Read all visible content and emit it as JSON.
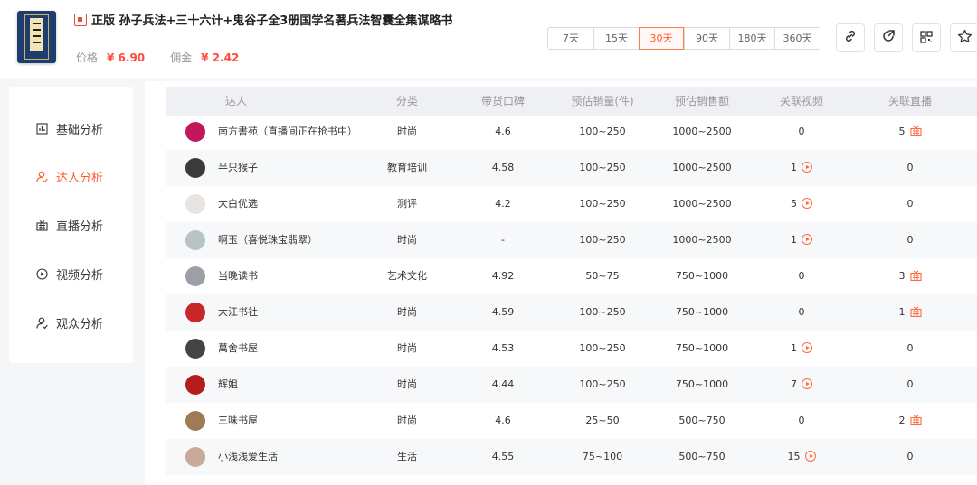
{
  "product": {
    "title": "正版 孙子兵法+三十六计+鬼谷子全3册国学名著兵法智囊全集谋略书",
    "price_label": "价格",
    "price": "¥ 6.90",
    "commission_label": "佣金",
    "commission": "¥ 2.42"
  },
  "time_ranges": [
    "7天",
    "15天",
    "30天",
    "90天",
    "180天",
    "360天"
  ],
  "active_range": "30天",
  "toolbar_icons": [
    "link-icon",
    "share-icon",
    "qrcode-icon",
    "star-icon"
  ],
  "sidebar": {
    "items": [
      {
        "label": "基础分析",
        "icon": "bar-chart-icon"
      },
      {
        "label": "达人分析",
        "icon": "person-icon",
        "active": true
      },
      {
        "label": "直播分析",
        "icon": "live-icon"
      },
      {
        "label": "视频分析",
        "icon": "play-icon"
      },
      {
        "label": "观众分析",
        "icon": "person-icon"
      }
    ]
  },
  "table": {
    "headers": [
      "达人",
      "分类",
      "带货口碑",
      "预估销量(件)",
      "预估销售额",
      "关联视频",
      "关联直播"
    ],
    "rows": [
      {
        "name": "南方書苑（直播间正在抢书中）",
        "category": "时尚",
        "rating": "4.6",
        "sales": "100~250",
        "revenue": "1000~2500",
        "videos": "0",
        "lives": "5",
        "avatar_color": "#c2185b"
      },
      {
        "name": "半只猴子",
        "category": "教育培训",
        "rating": "4.58",
        "sales": "100~250",
        "revenue": "1000~2500",
        "videos": "1",
        "lives": "0",
        "avatar_color": "#3a3a3a"
      },
      {
        "name": "大白优选",
        "category": "测评",
        "rating": "4.2",
        "sales": "100~250",
        "revenue": "1000~2500",
        "videos": "5",
        "lives": "0",
        "avatar_color": "#e9e4df"
      },
      {
        "name": "啊玉（喜悦珠宝翡翠）",
        "category": "时尚",
        "rating": "-",
        "sales": "100~250",
        "revenue": "1000~2500",
        "videos": "1",
        "lives": "0",
        "avatar_color": "#b7c4c1"
      },
      {
        "name": "当晚读书",
        "category": "艺术文化",
        "rating": "4.92",
        "sales": "50~75",
        "revenue": "750~1000",
        "videos": "0",
        "lives": "3",
        "avatar_color": "#9aa0a6"
      },
      {
        "name": "大江书社",
        "category": "时尚",
        "rating": "4.59",
        "sales": "100~250",
        "revenue": "750~1000",
        "videos": "0",
        "lives": "1",
        "avatar_color": "#c62828"
      },
      {
        "name": "萬舍书屋",
        "category": "时尚",
        "rating": "4.53",
        "sales": "100~250",
        "revenue": "750~1000",
        "videos": "1",
        "lives": "0",
        "avatar_color": "#444444"
      },
      {
        "name": "辉姐",
        "category": "时尚",
        "rating": "4.44",
        "sales": "100~250",
        "revenue": "750~1000",
        "videos": "7",
        "lives": "0",
        "avatar_color": "#b71c1c"
      },
      {
        "name": "三味书屋",
        "category": "时尚",
        "rating": "4.6",
        "sales": "25~50",
        "revenue": "500~750",
        "videos": "0",
        "lives": "2",
        "avatar_color": "#a07a55"
      },
      {
        "name": "小浅浅爱生活",
        "category": "生活",
        "rating": "4.55",
        "sales": "75~100",
        "revenue": "500~750",
        "videos": "15",
        "lives": "0",
        "avatar_color": "#c9a99a"
      }
    ]
  },
  "colors": {
    "accent": "#ff5a2c",
    "price": "#ff4a3c",
    "header_bg": "#eef0f4"
  }
}
